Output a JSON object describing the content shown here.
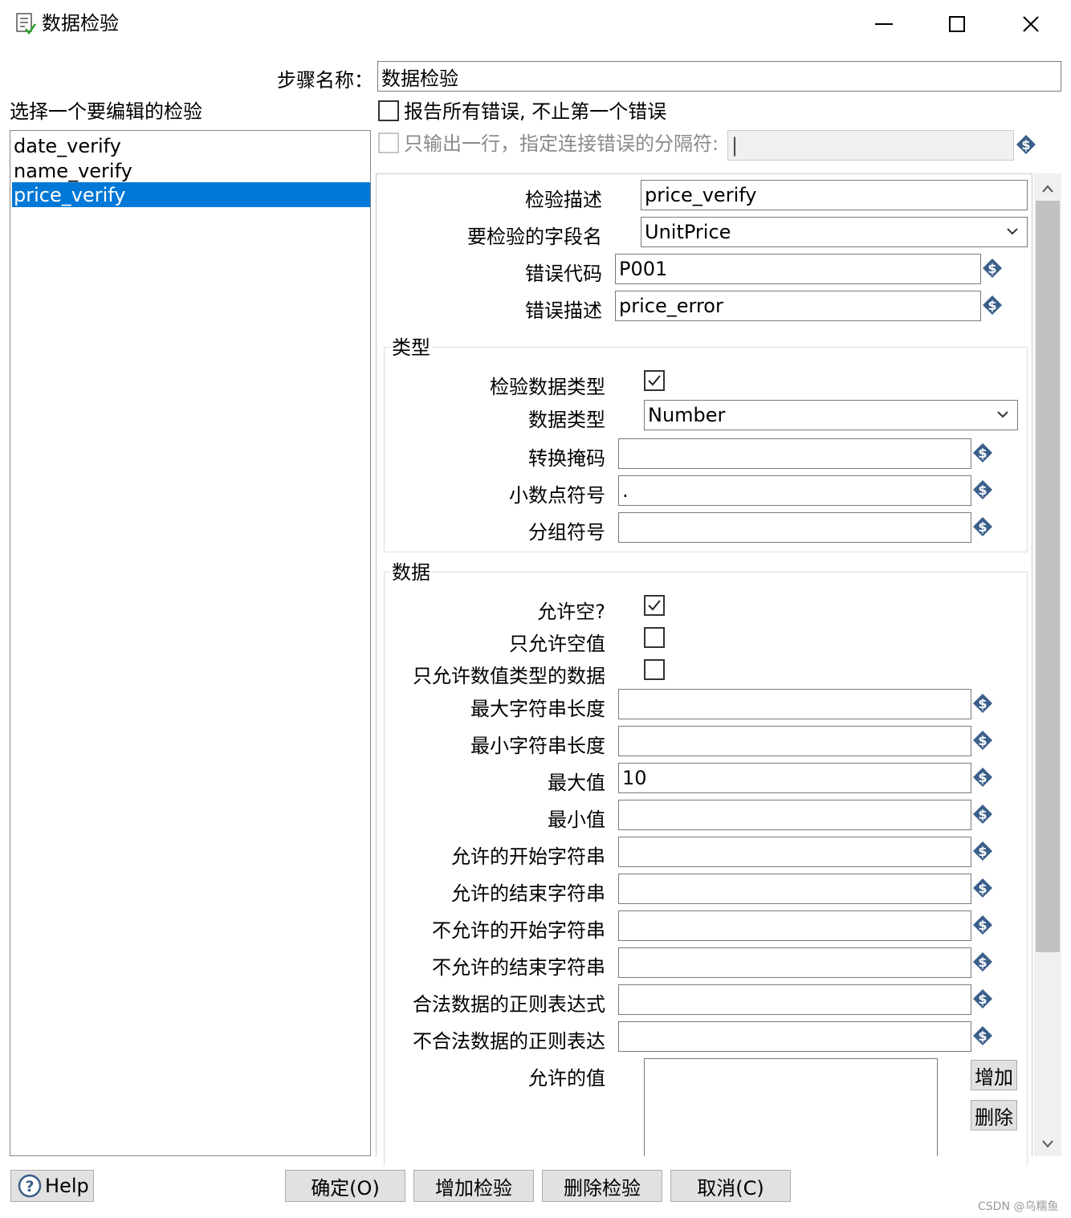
{
  "window": {
    "title": "数据检验",
    "minimize": "minimize",
    "maximize": "maximize",
    "close": "close"
  },
  "step_name": {
    "label": "步骤名称：",
    "value": "数据检验"
  },
  "report_all": {
    "label": "报告所有错误, 不止第一个错误",
    "checked": false
  },
  "one_row": {
    "label": "只输出一行，指定连接错误的分隔符:",
    "checked": false,
    "value": "|"
  },
  "left_panel": {
    "label": "选择一个要编辑的检验",
    "items": [
      "date_verify",
      "name_verify",
      "price_verify"
    ],
    "selected": 2
  },
  "validation": {
    "desc_label": "检验描述",
    "desc_value": "price_verify",
    "field_label": "要检验的字段名",
    "field_value": "UnitPrice",
    "error_code_label": "错误代码",
    "error_code_value": "P001",
    "error_desc_label": "错误描述",
    "error_desc_value": "price_error"
  },
  "type_group": {
    "title": "类型",
    "check_type_label": "检验数据类型",
    "check_type_checked": true,
    "data_type_label": "数据类型",
    "data_type_value": "Number",
    "conv_mask_label": "转换掩码",
    "conv_mask_value": "",
    "decimal_label": "小数点符号",
    "decimal_value": ".",
    "grouping_label": "分组符号",
    "grouping_value": ""
  },
  "data_group": {
    "title": "数据",
    "allow_null_label": "允许空?",
    "allow_null_checked": true,
    "only_null_label": "只允许空值",
    "only_null_checked": false,
    "only_numeric_label": "只允许数值类型的数据",
    "only_numeric_checked": false,
    "max_len_label": "最大字符串长度",
    "max_len_value": "",
    "min_len_label": "最小字符串长度",
    "min_len_value": "",
    "max_val_label": "最大值",
    "max_val_value": "10",
    "min_val_label": "最小值",
    "min_val_value": "",
    "start_allowed_label": "允许的开始字符串",
    "start_allowed_value": "",
    "end_allowed_label": "允许的结束字符串",
    "end_allowed_value": "",
    "start_disallowed_label": "不允许的开始字符串",
    "start_disallowed_value": "",
    "end_disallowed_label": "不允许的结束字符串",
    "end_disallowed_value": "",
    "regex_valid_label": "合法数据的正则表达式",
    "regex_valid_value": "",
    "regex_invalid_label": "不合法数据的正则表达",
    "regex_invalid_value": "",
    "allowed_values_label": "允许的值",
    "add_label": "增加",
    "delete_label": "删除"
  },
  "footer": {
    "help": "Help",
    "ok": "确定(O)",
    "add_check": "增加检验",
    "delete_check": "删除检验",
    "cancel": "取消(C)"
  },
  "watermark": "CSDN @乌糯鱼",
  "colors": {
    "selection": "#0078d7",
    "var_icon": "#3a5f8a",
    "button_bg": "#e1e1e1"
  }
}
